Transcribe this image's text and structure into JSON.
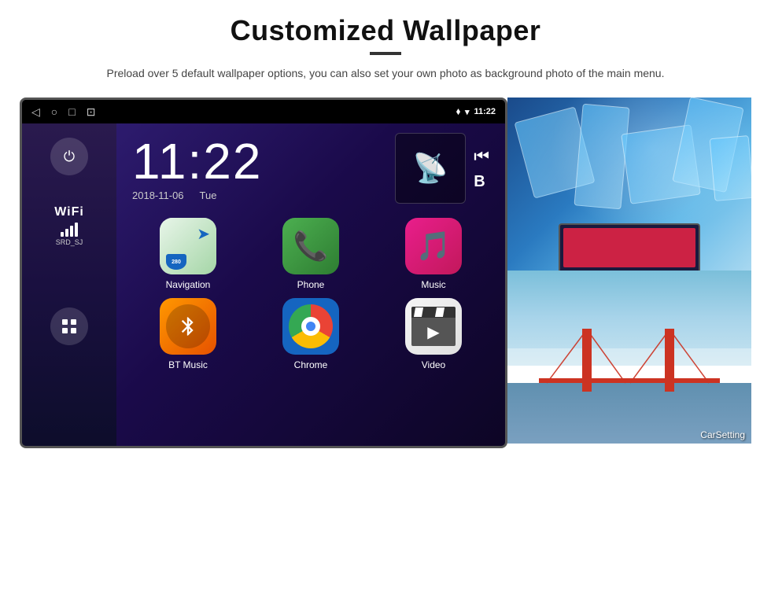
{
  "page": {
    "title": "Customized Wallpaper",
    "description": "Preload over 5 default wallpaper options, you can also set your own photo as background photo of the main menu."
  },
  "device": {
    "statusBar": {
      "time": "11:22",
      "navIcons": [
        "◁",
        "○",
        "□",
        "⊡"
      ],
      "rightIcons": [
        "location",
        "wifi",
        "signal"
      ]
    },
    "clock": {
      "time": "11:22",
      "date": "2018-11-06",
      "day": "Tue"
    },
    "sidebar": {
      "powerLabel": "⏻",
      "wifiLabel": "WiFi",
      "ssid": "SRD_SJ",
      "appsLabel": "⊞"
    },
    "apps": [
      {
        "name": "Navigation",
        "icon": "navigation"
      },
      {
        "name": "Phone",
        "icon": "phone"
      },
      {
        "name": "Music",
        "icon": "music"
      },
      {
        "name": "BT Music",
        "icon": "btmusic"
      },
      {
        "name": "Chrome",
        "icon": "chrome"
      },
      {
        "name": "Video",
        "icon": "video"
      }
    ]
  },
  "wallpapers": [
    {
      "name": "Ice Blue",
      "description": "Ice cave blue wallpaper"
    },
    {
      "name": "Golden Gate Bridge",
      "description": "Bridge wallpaper",
      "label": "CarSetting"
    }
  ]
}
